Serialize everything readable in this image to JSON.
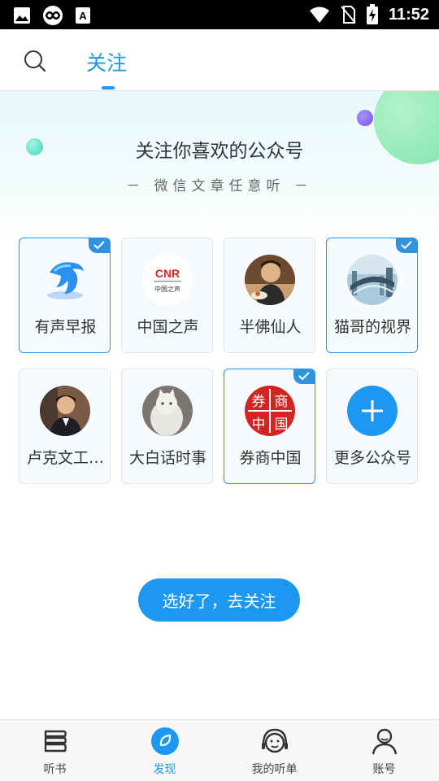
{
  "status_bar": {
    "time": "11:52",
    "left_icons": [
      "image-icon",
      "infinity-app-icon",
      "font-app-icon"
    ],
    "right_icons": [
      "wifi-icon",
      "no-sim-icon",
      "battery-charging-icon"
    ]
  },
  "header": {
    "search_icon": "search-icon",
    "active_tab": "关注"
  },
  "hero": {
    "title": "关注你喜欢的公众号",
    "subtitle": "－ 微信文章任意听 －"
  },
  "cards": [
    {
      "label": "有声早报",
      "selected": true,
      "icon": "dolphin-logo-icon"
    },
    {
      "label": "中国之声",
      "selected": false,
      "icon": "cnr-logo-icon"
    },
    {
      "label": "半佛仙人",
      "selected": false,
      "icon": "person-photo-avatar"
    },
    {
      "label": "猫哥的视界",
      "selected": true,
      "icon": "city-road-photo-avatar"
    },
    {
      "label": "卢克文工…",
      "selected": false,
      "icon": "man-photo-avatar"
    },
    {
      "label": "大白话时事",
      "selected": false,
      "icon": "white-cat-photo-avatar"
    },
    {
      "label": "券商中国",
      "selected": true,
      "icon": "quanshang-logo-icon"
    },
    {
      "label": "更多公众号",
      "selected": false,
      "icon": "plus-icon"
    }
  ],
  "cta_button": "选好了，去关注",
  "bottom_nav": [
    {
      "label": "听书",
      "icon": "books-icon",
      "active": false
    },
    {
      "label": "发现",
      "icon": "compass-icon",
      "active": true
    },
    {
      "label": "我的听单",
      "icon": "headphones-face-icon",
      "active": false
    },
    {
      "label": "账号",
      "icon": "user-icon",
      "active": false
    }
  ],
  "colors": {
    "accent": "#1c98f2",
    "selected_border": "#2f93e0",
    "status_bar": "#000000"
  }
}
